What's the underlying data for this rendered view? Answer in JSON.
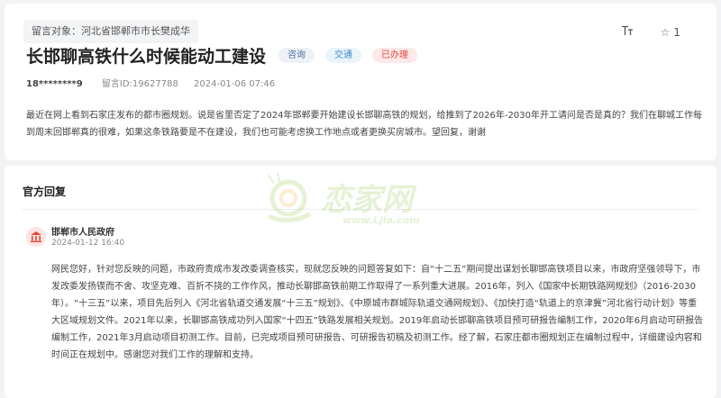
{
  "message": {
    "target_label": "留言对象：河北省邯郸市市长樊成华",
    "font_size_icon": "text-size-icon",
    "star_count": "1",
    "title": "长邯聊高铁什么时候能动工建设",
    "badges": {
      "type": "咨询",
      "category": "交通",
      "status": "已办理"
    },
    "author": "18********9",
    "message_id": "留言ID:19627788",
    "date": "2024-01-06 07:46",
    "content": "最近在网上看到石家庄发布的都市圈规划。说是省里否定了2024年邯郸要开始建设长邯聊高铁的规划，给推到了2026年-2030年开工请问是否是真的？我们在聊城工作每到周末回邯郸真的很难，如果这条铁路要是不在建设，我们也可能考虑换工作地点或者更换买房城市。望回复，谢谢"
  },
  "reply": {
    "section_title": "官方回复",
    "org_name": "邯郸市人民政府",
    "date": "2024-01-12 16:40",
    "content": "网民您好，针对您反映的问题，市政府责成市发改委调查核实，现就您反映的问题答复如下：自“十二五”期间提出谋划长聊邯高铁项目以来，市政府坚强领导下，市发改委发扬锲而不舍、攻坚克难、百折不挠的工作作风，推动长聊邯高铁前期工作取得了一系列重大进展。2016年，列入《国家中长期铁路网规划》（2016-2030年）。“十三五”以来，项目先后列入《河北省轨道交通发展“十三五”规划》、《中原城市群城际轨道交通网规划》、《加快打造“轨道上的京津冀”河北省行动计划》等重大区域规划文件。2021年以来，长聊邯高铁成功列入国家“十四五”铁路发展相关规划。2019年启动长邯聊高铁项目预可研报告编制工作，2020年6月启动可研报告编制工作，2021年3月启动项目初测工作。目前，已完成项目预可研报告、可研报告初稿及初测工作。经了解，石家庄都市圈规划正在编制过程中，详细建设内容和时间正在规划中。感谢您对我们工作的理解和支持。"
  },
  "watermark": {
    "text": "恋家网",
    "url": "www.Ljia.com"
  },
  "colors": {
    "page_bg": "#f2f3f5",
    "status_red": "#e2483d",
    "info_blue": "#4d6fa8",
    "watermark_green": "#8fc24a"
  }
}
